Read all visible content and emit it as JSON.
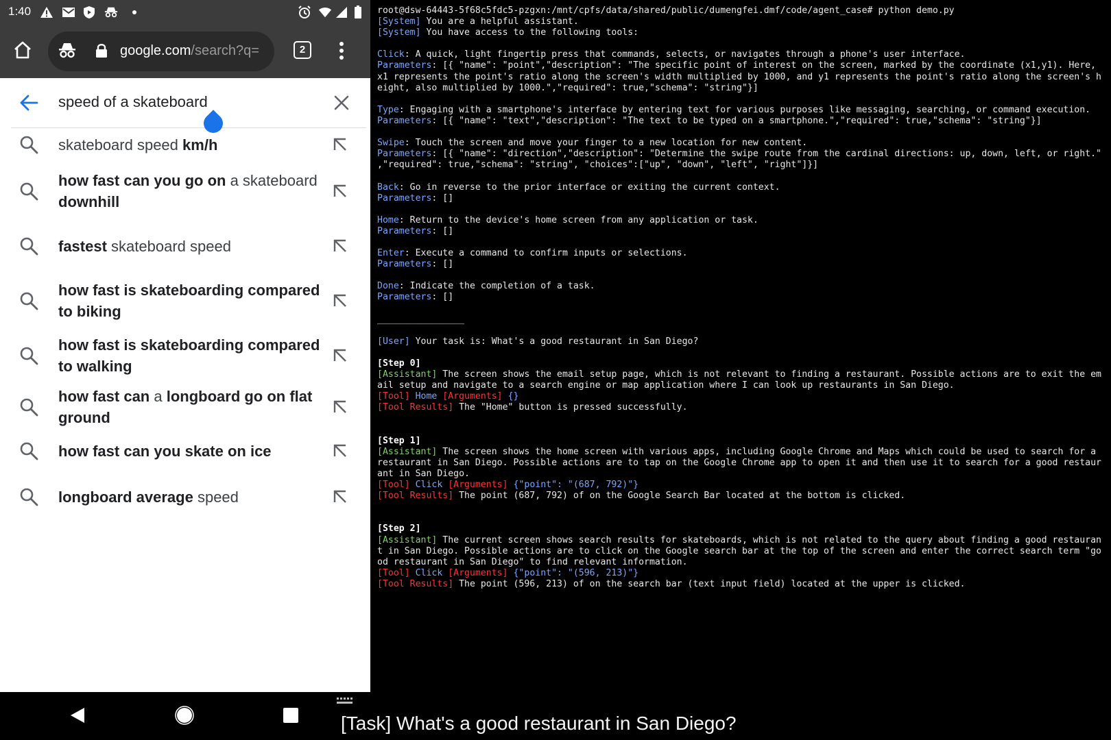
{
  "status_bar": {
    "time": "1:40"
  },
  "browser": {
    "url_host": "google.com",
    "url_path": "/search?q=",
    "tab_count": "2"
  },
  "search": {
    "query": "speed of a skateboard",
    "suggestions": [
      {
        "parts": [
          {
            "t": "skateboard speed ",
            "b": false
          },
          {
            "t": "km/h",
            "b": true
          }
        ]
      },
      {
        "parts": [
          {
            "t": "how fast can you go on",
            "b": true
          },
          {
            "t": " a skateboard ",
            "b": false
          },
          {
            "t": "downhill",
            "b": true
          }
        ]
      },
      {
        "parts": [
          {
            "t": "fastest",
            "b": true
          },
          {
            "t": " skateboard speed",
            "b": false
          }
        ]
      },
      {
        "parts": [
          {
            "t": "how fast is skateboarding compared to biking",
            "b": true
          }
        ]
      },
      {
        "parts": [
          {
            "t": "how fast is skateboarding compared to walking",
            "b": true
          }
        ]
      },
      {
        "parts": [
          {
            "t": "how fast can",
            "b": true
          },
          {
            "t": " a ",
            "b": false
          },
          {
            "t": "longboard go on flat ground",
            "b": true
          }
        ]
      },
      {
        "parts": [
          {
            "t": "how fast can you skate on ice",
            "b": true
          }
        ]
      },
      {
        "parts": [
          {
            "t": "longboard average",
            "b": true
          },
          {
            "t": " speed",
            "b": false
          }
        ]
      }
    ]
  },
  "terminal": {
    "lines": [
      [
        {
          "c": "",
          "t": "root@dsw-64443-5f68c5fdc5-pzgxn:/mnt/cpfs/data/shared/public/dumengfei.dmf/code/agent_case# python demo.py"
        }
      ],
      [
        {
          "c": "c-sys",
          "t": "[System]"
        },
        {
          "c": "",
          "t": " You are a helpful assistant."
        }
      ],
      [
        {
          "c": "c-sys",
          "t": "[System]"
        },
        {
          "c": "",
          "t": " You have access to the following tools:"
        }
      ],
      [],
      [
        {
          "c": "c-blue",
          "t": "Click"
        },
        {
          "c": "",
          "t": ": A quick, light fingertip press that commands, selects, or navigates through a phone's user interface."
        }
      ],
      [
        {
          "c": "c-param",
          "t": "Parameters"
        },
        {
          "c": "",
          "t": ": [{ \"name\": \"point\",\"description\": \"The specific point of interest on the screen, marked by the coordinate (x1,y1). Here,"
        }
      ],
      [
        {
          "c": "",
          "t": "x1 represents the point's ratio along the screen's width multiplied by 1000, and y1 represents the point's ratio along the screen's h"
        }
      ],
      [
        {
          "c": "",
          "t": "eight, also multiplied by 1000.\",\"required\": true,\"schema\": \"string\"}]"
        }
      ],
      [],
      [
        {
          "c": "c-blue",
          "t": "Type"
        },
        {
          "c": "",
          "t": ": Engaging with a smartphone's interface by entering text for various purposes like messaging, searching, or command execution."
        }
      ],
      [
        {
          "c": "c-param",
          "t": "Parameters"
        },
        {
          "c": "",
          "t": ": [{ \"name\": \"text\",\"description\": \"The text to be typed on a smartphone.\",\"required\": true,\"schema\": \"string\"}]"
        }
      ],
      [],
      [
        {
          "c": "c-blue",
          "t": "Swipe"
        },
        {
          "c": "",
          "t": ": Touch the screen and move your finger to a new location for new content."
        }
      ],
      [
        {
          "c": "c-param",
          "t": "Parameters"
        },
        {
          "c": "",
          "t": ": [{ \"name\": \"direction\",\"description\": \"Determine the swipe route from the cardinal directions: up, down, left, or right.\""
        }
      ],
      [
        {
          "c": "",
          "t": ",\"required\": true,\"schema\": \"string\", \"choices\":[\"up\", \"down\", \"left\", \"right\"]}]"
        }
      ],
      [],
      [
        {
          "c": "c-blue",
          "t": "Back"
        },
        {
          "c": "",
          "t": ": Go in reverse to the prior interface or exiting the current context."
        }
      ],
      [
        {
          "c": "c-param",
          "t": "Parameters"
        },
        {
          "c": "",
          "t": ": []"
        }
      ],
      [],
      [
        {
          "c": "c-blue",
          "t": "Home"
        },
        {
          "c": "",
          "t": ": Return to the device's home screen from any application or task."
        }
      ],
      [
        {
          "c": "c-param",
          "t": "Parameters"
        },
        {
          "c": "",
          "t": ": []"
        }
      ],
      [],
      [
        {
          "c": "c-blue",
          "t": "Enter"
        },
        {
          "c": "",
          "t": ": Execute a command to confirm inputs or selections."
        }
      ],
      [
        {
          "c": "c-param",
          "t": "Parameters"
        },
        {
          "c": "",
          "t": ": []"
        }
      ],
      [],
      [
        {
          "c": "c-blue",
          "t": "Done"
        },
        {
          "c": "",
          "t": ": Indicate the completion of a task."
        }
      ],
      [
        {
          "c": "c-param",
          "t": "Parameters"
        },
        {
          "c": "",
          "t": ": []"
        }
      ],
      [],
      [
        {
          "c": "",
          "t": "________________"
        }
      ],
      [],
      [
        {
          "c": "c-user",
          "t": "[User]"
        },
        {
          "c": "",
          "t": " Your task is: What's a good restaurant in San Diego?"
        }
      ],
      [],
      [
        {
          "c": "c-step",
          "t": "[Step 0]"
        }
      ],
      [
        {
          "c": "c-asst",
          "t": "[Assistant]"
        },
        {
          "c": "",
          "t": " The screen shows the email setup page, which is not relevant to finding a restaurant. Possible actions are to exit the em"
        }
      ],
      [
        {
          "c": "",
          "t": "ail setup and navigate to a search engine or map application where I can look up restaurants in San Diego."
        }
      ],
      [
        {
          "c": "c-red",
          "t": "[Tool]"
        },
        {
          "c": "c-blue",
          "t": " Home "
        },
        {
          "c": "c-red",
          "t": "[Arguments]"
        },
        {
          "c": "c-blue",
          "t": " {}"
        }
      ],
      [
        {
          "c": "c-red",
          "t": "[Tool Results]"
        },
        {
          "c": "",
          "t": " The \"Home\" button is pressed successfully."
        }
      ],
      [],
      [],
      [
        {
          "c": "c-step",
          "t": "[Step 1]"
        }
      ],
      [
        {
          "c": "c-asst",
          "t": "[Assistant]"
        },
        {
          "c": "",
          "t": " The screen shows the home screen with various apps, including Google Chrome and Maps which could be used to search for a"
        }
      ],
      [
        {
          "c": "",
          "t": "restaurant in San Diego. Possible actions are to tap on the Google Chrome app to open it and then use it to search for a good restaur"
        }
      ],
      [
        {
          "c": "",
          "t": "ant in San Diego."
        }
      ],
      [
        {
          "c": "c-red",
          "t": "[Tool]"
        },
        {
          "c": "c-blue",
          "t": " Click "
        },
        {
          "c": "c-red",
          "t": "[Arguments]"
        },
        {
          "c": "c-blue",
          "t": " {\"point\": \"(687, 792)\"}"
        }
      ],
      [
        {
          "c": "c-red",
          "t": "[Tool Results]"
        },
        {
          "c": "",
          "t": " The point (687, 792) of on the Google Search Bar located at the bottom is clicked."
        }
      ],
      [],
      [],
      [
        {
          "c": "c-step",
          "t": "[Step 2]"
        }
      ],
      [
        {
          "c": "c-asst",
          "t": "[Assistant]"
        },
        {
          "c": "",
          "t": " The current screen shows search results for skateboards, which is not related to the query about finding a good restauran"
        }
      ],
      [
        {
          "c": "",
          "t": "t in San Diego. Possible actions are to click on the Google search bar at the top of the screen and enter the correct search term \"go"
        }
      ],
      [
        {
          "c": "",
          "t": "od restaurant in San Diego\" to find relevant information."
        }
      ],
      [
        {
          "c": "c-red",
          "t": "[Tool]"
        },
        {
          "c": "c-blue",
          "t": " Click "
        },
        {
          "c": "c-red",
          "t": "[Arguments]"
        },
        {
          "c": "c-blue",
          "t": " {\"point\": \"(596, 213)\"}"
        }
      ],
      [
        {
          "c": "c-red",
          "t": "[Tool Results]"
        },
        {
          "c": "",
          "t": " The point (596, 213) of on the search bar (text input field) located at the upper is clicked."
        }
      ]
    ]
  },
  "caption": "[Task] What's a good restaurant in San Diego?",
  "colors": {
    "accent": "#1a73e8",
    "chrome_bar": "#3c3c3c"
  },
  "icons": [
    "warning-icon",
    "gmail-icon",
    "shield-icon",
    "incognito-icon",
    "alarm-icon",
    "wifi-icon",
    "signal-icon",
    "battery-icon",
    "home-icon",
    "lock-icon",
    "tab-switcher-icon",
    "more-vert-icon",
    "back-arrow-icon",
    "clear-icon",
    "search-icon",
    "fill-query-arrow-icon",
    "nav-back-icon",
    "nav-home-icon",
    "nav-recents-icon",
    "keyboard-icon"
  ]
}
